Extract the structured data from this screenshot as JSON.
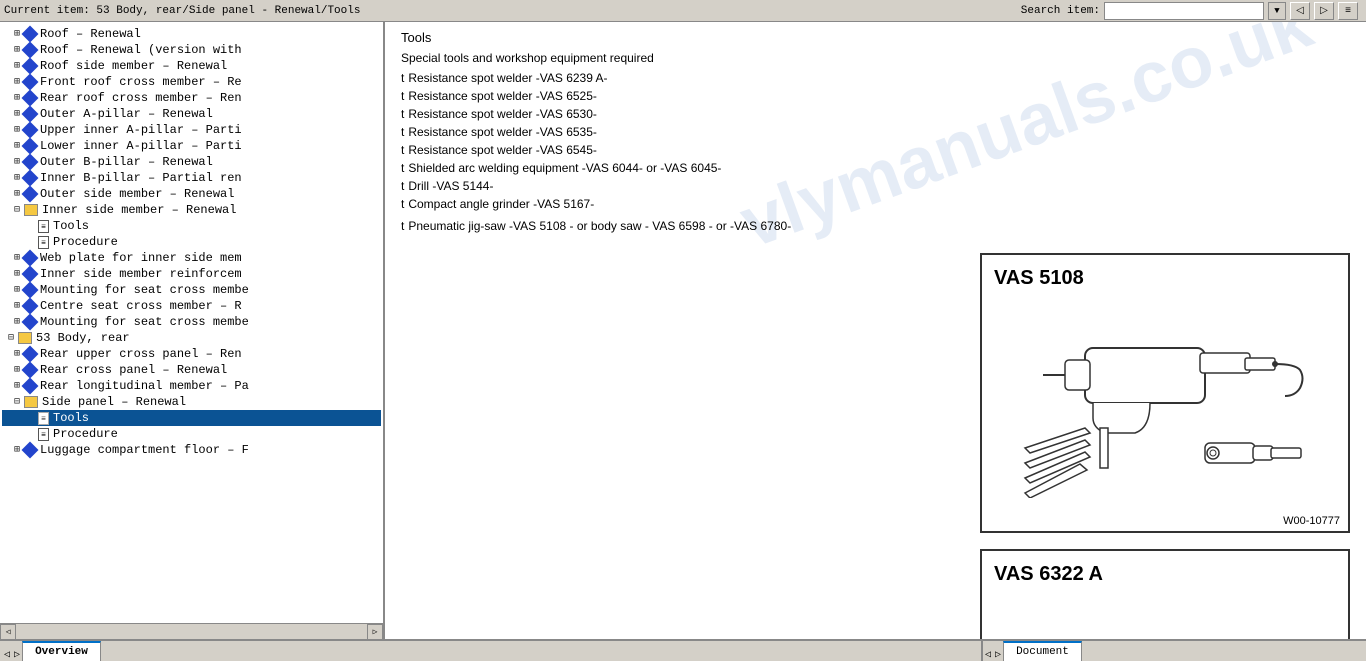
{
  "topbar": {
    "current_item": "Current item: 53 Body, rear/Side panel - Renewal/Tools",
    "search_label": "Search item:",
    "search_placeholder": ""
  },
  "left_panel": {
    "tree_items": [
      {
        "id": 1,
        "indent": 1,
        "type": "expandable",
        "expanded": true,
        "icon": "diamond",
        "label": "Roof – Renewal"
      },
      {
        "id": 2,
        "indent": 1,
        "type": "expandable",
        "expanded": false,
        "icon": "diamond",
        "label": "Roof – Renewal (version with"
      },
      {
        "id": 3,
        "indent": 1,
        "type": "expandable",
        "expanded": false,
        "icon": "diamond",
        "label": "Roof side member – Renewal"
      },
      {
        "id": 4,
        "indent": 1,
        "type": "expandable",
        "expanded": false,
        "icon": "diamond",
        "label": "Front roof cross member – Re"
      },
      {
        "id": 5,
        "indent": 1,
        "type": "expandable",
        "expanded": false,
        "icon": "diamond",
        "label": "Rear roof cross member – Ren"
      },
      {
        "id": 6,
        "indent": 1,
        "type": "expandable",
        "expanded": false,
        "icon": "diamond",
        "label": "Outer A-pillar – Renewal"
      },
      {
        "id": 7,
        "indent": 1,
        "type": "expandable",
        "expanded": false,
        "icon": "diamond",
        "label": "Upper inner A-pillar – Parti"
      },
      {
        "id": 8,
        "indent": 1,
        "type": "expandable",
        "expanded": false,
        "icon": "diamond",
        "label": "Lower inner A-pillar – Parti"
      },
      {
        "id": 9,
        "indent": 1,
        "type": "expandable",
        "expanded": false,
        "icon": "diamond",
        "label": "Outer B-pillar – Renewal"
      },
      {
        "id": 10,
        "indent": 1,
        "type": "expandable",
        "expanded": false,
        "icon": "diamond",
        "label": "Inner B-pillar – Partial ren"
      },
      {
        "id": 11,
        "indent": 1,
        "type": "expandable",
        "expanded": false,
        "icon": "diamond",
        "label": "Outer side member – Renewal"
      },
      {
        "id": 12,
        "indent": 1,
        "type": "expandable",
        "expanded": true,
        "icon": "folder",
        "label": "Inner side member – Renewal"
      },
      {
        "id": 13,
        "indent": 2,
        "type": "leaf",
        "icon": "doc",
        "label": "Tools",
        "selected": false
      },
      {
        "id": 14,
        "indent": 2,
        "type": "leaf",
        "icon": "doc",
        "label": "Procedure"
      },
      {
        "id": 15,
        "indent": 1,
        "type": "expandable",
        "expanded": false,
        "icon": "diamond",
        "label": "Web plate for inner side mem"
      },
      {
        "id": 16,
        "indent": 1,
        "type": "expandable",
        "expanded": false,
        "icon": "diamond",
        "label": "Inner side member reinforcem"
      },
      {
        "id": 17,
        "indent": 1,
        "type": "expandable",
        "expanded": false,
        "icon": "diamond",
        "label": "Mounting for seat cross membe"
      },
      {
        "id": 18,
        "indent": 1,
        "type": "expandable",
        "expanded": false,
        "icon": "diamond",
        "label": "Centre seat cross member – R"
      },
      {
        "id": 19,
        "indent": 1,
        "type": "expandable",
        "expanded": false,
        "icon": "diamond",
        "label": "Mounting for seat cross membe"
      },
      {
        "id": 20,
        "indent": 0,
        "type": "expandable",
        "expanded": true,
        "icon": "folder",
        "label": "53 Body, rear"
      },
      {
        "id": 21,
        "indent": 1,
        "type": "expandable",
        "expanded": false,
        "icon": "diamond",
        "label": "Rear upper cross panel – Ren"
      },
      {
        "id": 22,
        "indent": 1,
        "type": "expandable",
        "expanded": false,
        "icon": "diamond",
        "label": "Rear cross panel – Renewal"
      },
      {
        "id": 23,
        "indent": 1,
        "type": "expandable",
        "expanded": false,
        "icon": "diamond",
        "label": "Rear longitudinal member – Pa"
      },
      {
        "id": 24,
        "indent": 1,
        "type": "expandable",
        "expanded": true,
        "icon": "folder",
        "label": "Side panel – Renewal"
      },
      {
        "id": 25,
        "indent": 2,
        "type": "leaf",
        "icon": "doc",
        "label": "Tools",
        "selected": true
      },
      {
        "id": 26,
        "indent": 2,
        "type": "leaf",
        "icon": "doc",
        "label": "Procedure"
      },
      {
        "id": 27,
        "indent": 1,
        "type": "expandable",
        "expanded": false,
        "icon": "diamond",
        "label": "Luggage compartment floor – F"
      }
    ]
  },
  "right_panel": {
    "title": "Tools",
    "subtitle": "Special tools and workshop equipment required",
    "tools": [
      {
        "bullet": "t",
        "text": "Resistance spot welder -VAS 6239 A-"
      },
      {
        "bullet": "t",
        "text": "Resistance spot welder -VAS 6525-"
      },
      {
        "bullet": "t",
        "text": "Resistance spot welder -VAS 6530-"
      },
      {
        "bullet": "t",
        "text": "Resistance spot welder -VAS 6535-"
      },
      {
        "bullet": "t",
        "text": "Resistance spot welder -VAS 6545-"
      },
      {
        "bullet": "t",
        "text": "Shielded arc welding equipment -VAS 6044- or -VAS 6045-"
      },
      {
        "bullet": "t",
        "text": "Drill -VAS 5144-"
      },
      {
        "bullet": "t",
        "text": "Compact angle grinder -VAS 5167-"
      },
      {
        "bullet": "t",
        "text": "Pneumatic jig-saw -VAS 5108 - or body saw - VAS 6598 - or -VAS 6780-"
      }
    ],
    "vas_5108": {
      "title": "VAS 5108",
      "ref": "W00-10777"
    },
    "vas_6322": {
      "title": "VAS 6322 A"
    }
  },
  "bottom_bar": {
    "left_tabs": [
      {
        "label": "Overview",
        "active": false
      }
    ],
    "right_tabs": [
      {
        "label": "Document",
        "active": true
      }
    ]
  },
  "toolbar_buttons": {
    "btn1": "👤",
    "btn2": "👤",
    "btn3": "≡"
  }
}
